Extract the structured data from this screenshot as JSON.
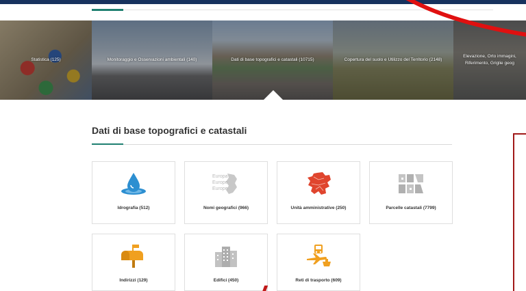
{
  "carousel": {
    "items": [
      {
        "label": "Statistica (125)"
      },
      {
        "label": "Monitoraggio e Osservazioni ambientali (140)"
      },
      {
        "label": "Dati di base topografici e catastali (10715)"
      },
      {
        "label": "Copertura del suolo e Utilizzo del Territorio (2148)"
      },
      {
        "label": "Elevazione, Orto immagini, Riferimento, Griglie geog"
      }
    ],
    "active_index": 2
  },
  "section": {
    "title": "Dati di base topografici e catastali"
  },
  "categories": [
    {
      "label": "Idrografia (512)",
      "icon": "water-drop-icon"
    },
    {
      "label": "Nomi geografici (966)",
      "icon": "europe-names-icon",
      "icon_text": [
        "Europa",
        "Europe",
        "Europe"
      ]
    },
    {
      "label": "Unità amministrative (250)",
      "icon": "europe-map-icon"
    },
    {
      "label": "Parcelle catastali (7799)",
      "icon": "parcels-icon"
    },
    {
      "label": "Indirizzi (129)",
      "icon": "mailbox-icon"
    },
    {
      "label": "Edifici (450)",
      "icon": "buildings-icon"
    },
    {
      "label": "Reti di trasporto (609)",
      "icon": "transport-icon"
    }
  ],
  "colors": {
    "topbar": "#17325e",
    "accent": "#1e7f70",
    "annotation_red": "#c01818",
    "icon_blue": "#2d8fd1",
    "icon_orange": "#f0a020",
    "icon_red": "#e0452e"
  }
}
